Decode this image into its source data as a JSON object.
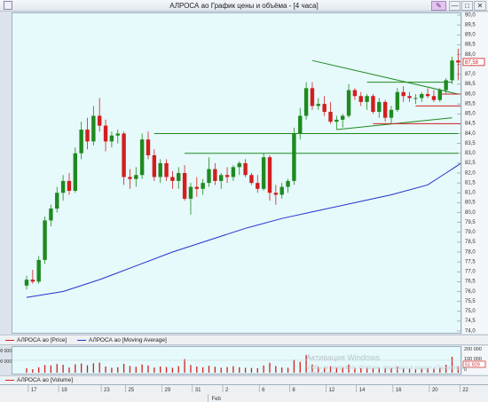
{
  "window": {
    "title": "АЛРОСА ао График цены и объёма - [4 часа]",
    "buttons": {
      "edit": "✎",
      "minimize": "—",
      "maximize": "□",
      "close": "✕"
    }
  },
  "legend": {
    "price": "АЛРОСА ао [Price]",
    "ma": "АЛРОСА ао [Moving Average]",
    "volume": "АЛРОСА ао [Volume]"
  },
  "watermark": {
    "line1": "Активация Windows",
    "line2": "Чтобы активировать Windows, перейдите в раздел «Параметры» компьютера."
  },
  "colors": {
    "up": "#1f8a1f",
    "down": "#d21e1e",
    "ma": "#2233cc",
    "background": "#e6f9fb",
    "volume_bar": "#d21e1e"
  },
  "chart_data": [
    {
      "type": "candlestick",
      "ylim": [
        74.0,
        90.0
      ],
      "y_ticks": [
        "90,0",
        "89,5",
        "89,0",
        "88,5",
        "88,0",
        "87,5",
        "87,0",
        "86,5",
        "86,0",
        "85,5",
        "85,0",
        "84,5",
        "84,0",
        "83,5",
        "83,0",
        "82,5",
        "82,0",
        "81,5",
        "81,0",
        "80,5",
        "80,0",
        "79,5",
        "79,0",
        "78,5",
        "78,0",
        "77,5",
        "77,0",
        "76,5",
        "76,0",
        "75,5",
        "75,0",
        "74,5",
        "74,0"
      ],
      "last_price_label": "87,58",
      "candles": [
        [
          76.3,
          76.8,
          76.1,
          76.6
        ],
        [
          76.6,
          77.1,
          76.4,
          76.5
        ],
        [
          76.5,
          77.8,
          76.4,
          77.6
        ],
        [
          77.6,
          79.8,
          77.4,
          79.6
        ],
        [
          79.6,
          80.4,
          79.3,
          80.2
        ],
        [
          80.2,
          81.3,
          80.0,
          81.0
        ],
        [
          81.0,
          81.9,
          80.6,
          81.6
        ],
        [
          81.6,
          82.0,
          80.9,
          81.1
        ],
        [
          81.1,
          83.3,
          81.0,
          83.0
        ],
        [
          83.0,
          84.6,
          82.7,
          84.2
        ],
        [
          84.2,
          84.8,
          83.2,
          83.6
        ],
        [
          83.6,
          85.4,
          83.4,
          84.9
        ],
        [
          84.9,
          85.8,
          84.1,
          84.4
        ],
        [
          84.4,
          84.7,
          83.1,
          83.6
        ],
        [
          83.6,
          84.1,
          83.3,
          83.9
        ],
        [
          83.9,
          84.2,
          83.5,
          84.0
        ],
        [
          84.0,
          84.1,
          81.4,
          81.8
        ],
        [
          81.8,
          82.2,
          81.2,
          81.7
        ],
        [
          81.7,
          82.3,
          81.3,
          81.9
        ],
        [
          81.9,
          84.0,
          81.7,
          83.7
        ],
        [
          83.7,
          84.1,
          82.7,
          82.9
        ],
        [
          82.9,
          83.2,
          81.6,
          81.8
        ],
        [
          81.8,
          82.7,
          81.5,
          82.5
        ],
        [
          82.5,
          82.7,
          81.6,
          81.8
        ],
        [
          81.8,
          82.1,
          81.2,
          81.6
        ],
        [
          81.6,
          82.3,
          81.2,
          82.0
        ],
        [
          82.0,
          82.4,
          80.6,
          80.7
        ],
        [
          80.7,
          81.5,
          79.9,
          81.3
        ],
        [
          81.3,
          81.8,
          80.8,
          81.2
        ],
        [
          81.2,
          81.7,
          80.9,
          81.5
        ],
        [
          81.5,
          82.8,
          81.3,
          82.2
        ],
        [
          82.2,
          82.5,
          81.4,
          81.6
        ],
        [
          81.6,
          82.0,
          81.2,
          81.9
        ],
        [
          81.9,
          82.3,
          81.5,
          81.8
        ],
        [
          81.8,
          82.4,
          81.6,
          82.3
        ],
        [
          82.3,
          82.6,
          81.9,
          82.5
        ],
        [
          82.5,
          82.7,
          81.8,
          81.9
        ],
        [
          81.9,
          82.0,
          81.4,
          81.5
        ],
        [
          81.5,
          81.9,
          81.0,
          81.2
        ],
        [
          81.2,
          83.0,
          81.1,
          82.8
        ],
        [
          82.8,
          82.9,
          80.6,
          81.0
        ],
        [
          81.0,
          81.4,
          80.4,
          80.9
        ],
        [
          80.9,
          81.5,
          80.7,
          81.3
        ],
        [
          81.3,
          81.7,
          81.0,
          81.6
        ],
        [
          81.6,
          84.3,
          81.4,
          84.0
        ],
        [
          84.0,
          85.3,
          83.7,
          84.9
        ],
        [
          84.9,
          86.6,
          84.7,
          86.3
        ],
        [
          86.3,
          86.6,
          85.2,
          85.4
        ],
        [
          85.4,
          85.8,
          85.2,
          85.5
        ],
        [
          85.5,
          85.9,
          84.9,
          85.1
        ],
        [
          85.1,
          85.6,
          84.5,
          84.6
        ],
        [
          84.6,
          84.9,
          84.2,
          84.7
        ],
        [
          84.7,
          85.0,
          84.3,
          84.9
        ],
        [
          84.9,
          86.5,
          84.8,
          86.2
        ],
        [
          86.2,
          86.3,
          85.7,
          85.9
        ],
        [
          85.9,
          86.1,
          85.4,
          85.6
        ],
        [
          85.6,
          86.0,
          85.2,
          85.9
        ],
        [
          85.9,
          86.0,
          85.0,
          85.1
        ],
        [
          85.1,
          85.8,
          84.8,
          85.6
        ],
        [
          85.6,
          85.7,
          84.6,
          84.8
        ],
        [
          84.8,
          85.4,
          84.5,
          85.2
        ],
        [
          85.2,
          86.3,
          85.1,
          86.1
        ],
        [
          86.1,
          86.4,
          85.6,
          85.9
        ],
        [
          85.9,
          86.1,
          85.6,
          85.8
        ],
        [
          85.8,
          86.0,
          85.5,
          85.8
        ],
        [
          85.8,
          86.1,
          85.6,
          86.0
        ],
        [
          86.0,
          86.3,
          85.8,
          85.9
        ],
        [
          85.9,
          86.2,
          85.6,
          85.7
        ],
        [
          85.7,
          86.3,
          85.6,
          86.2
        ],
        [
          86.2,
          86.8,
          86.0,
          86.7
        ],
        [
          86.7,
          87.9,
          86.5,
          87.7
        ],
        [
          87.7,
          88.3,
          86.7,
          87.6
        ]
      ],
      "moving_average": [
        [
          0,
          75.7
        ],
        [
          6,
          76.0
        ],
        [
          12,
          76.6
        ],
        [
          18,
          77.3
        ],
        [
          24,
          78.0
        ],
        [
          30,
          78.6
        ],
        [
          36,
          79.2
        ],
        [
          42,
          79.7
        ],
        [
          48,
          80.1
        ],
        [
          54,
          80.5
        ],
        [
          60,
          80.9
        ],
        [
          66,
          81.4
        ],
        [
          69,
          82.0
        ],
        [
          72,
          82.6
        ],
        [
          75,
          83.0
        ],
        [
          78,
          83.3
        ],
        [
          81,
          83.6
        ],
        [
          84,
          83.8
        ]
      ],
      "trend_lines": [
        {
          "from": [
            0,
            85.2
          ],
          "to": [
            11,
            85.2
          ],
          "color": "#b81a1a",
          "note": "none"
        }
      ]
    },
    {
      "type": "bar",
      "ylim": [
        0,
        200000
      ],
      "y_ticks": [
        "200 000",
        "100 000",
        "0"
      ],
      "y_labels_right": [
        "200 000",
        "100 000",
        "0"
      ],
      "last_volume_label": "51 929",
      "values": [
        36,
        28,
        44,
        62,
        58,
        70,
        64,
        42,
        68,
        74,
        60,
        76,
        82,
        50,
        40,
        44,
        72,
        54,
        48,
        66,
        58,
        42,
        50,
        46,
        40,
        52,
        110,
        62,
        50,
        44,
        56,
        48,
        40,
        46,
        52,
        44,
        40,
        38,
        36,
        58,
        80,
        54,
        42,
        40,
        104,
        88,
        142,
        66,
        48,
        42,
        52,
        40,
        44,
        66,
        38,
        36,
        40,
        34,
        42,
        38,
        36,
        48,
        34,
        32,
        30,
        34,
        36,
        32,
        40,
        64,
        128,
        52
      ]
    }
  ],
  "date_axis": {
    "labels": [
      "17",
      "19",
      "23",
      "25",
      "29",
      "31",
      "2",
      "6",
      "8",
      "12",
      "14",
      "16",
      "20",
      "22"
    ],
    "month_label": "Feb"
  }
}
